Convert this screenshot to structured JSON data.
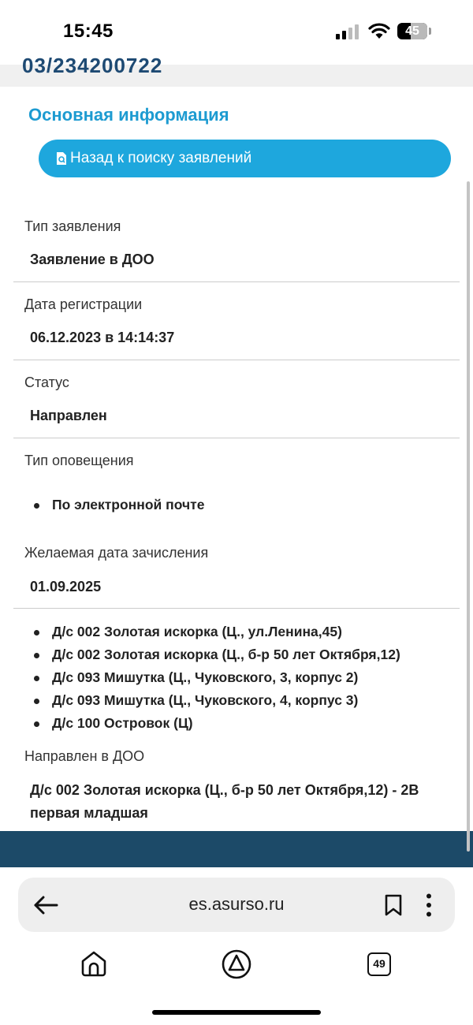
{
  "status_bar": {
    "time": "15:45",
    "battery": "45",
    "battery_fraction": 0.45
  },
  "page": {
    "top_strip_text": "03/234200722",
    "section_title": "Основная информация",
    "back_button_label": "Назад к поиску заявлений",
    "fields": {
      "type": {
        "label": "Тип заявления",
        "value": "Заявление в ДОО"
      },
      "date": {
        "label": "Дата регистрации",
        "value": "06.12.2023 в 14:14:37"
      },
      "status": {
        "label": "Статус",
        "value": "Направлен"
      },
      "notify": {
        "label": "Тип оповещения",
        "items": [
          "По электронной почте"
        ]
      },
      "desired": {
        "label": "Желаемая дата зачисления",
        "value": "01.09.2025"
      },
      "preferred": {
        "items": [
          "Д/с 002 Золотая искорка (Ц., ул.Ленина,45)",
          "Д/с 002 Золотая искорка (Ц., б-р 50 лет Октября,12)",
          "Д/с 093 Мишутка (Ц., Чуковского, 3, корпус 2)",
          "Д/с 093 Мишутка (Ц., Чуковского, 4, корпус 3)",
          "Д/с 100 Островок (Ц)"
        ]
      },
      "directed": {
        "label": "Направлен в ДОО",
        "value": "Д/с 002 Золотая искорка (Ц., б-р 50 лет Октября,12) - 2В первая младшая"
      }
    }
  },
  "browser": {
    "url": "es.asurso.ru",
    "tab_count": "49"
  },
  "colors": {
    "accent": "#1ea7dd",
    "title": "#1d9bd1",
    "footer": "#1c4a68"
  }
}
